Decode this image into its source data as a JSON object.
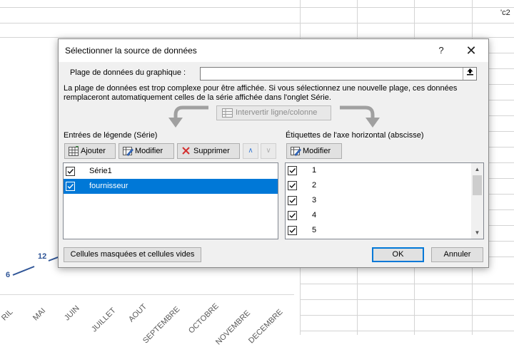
{
  "spreadsheet": {
    "cell_ref": "'c2",
    "chart_points": [
      "6",
      "12"
    ],
    "months": [
      "RIL",
      "MAI",
      "JUIN",
      "JUILLET",
      "AOUT",
      "SEPTEMBRE",
      "OCTOBRE",
      "NOVEMBRE",
      "DECEMBRE"
    ],
    "line_color": "#2f5597"
  },
  "dialog": {
    "title": "Sélectionner la source de données",
    "help_label": "?",
    "close_label": "✕",
    "range_label": "Plage de données du graphique :",
    "range_value": "",
    "range_button_icon": "collapse-dialog-icon",
    "message_line1": "La plage de données est trop complexe pour être affichée. Si vous sélectionnez une nouvelle plage, ces données",
    "message_line2": "remplaceront automatiquement celles de la série affichée dans l'onglet Série.",
    "switch_label": "Intervertir ligne/colonne",
    "legend": {
      "label": "Entrées de légende (Série)",
      "add_label": "Ajouter",
      "edit_label": "Modifier",
      "delete_label": "Supprimer",
      "up_label": "∧",
      "down_label": "∨",
      "series": [
        {
          "name": "Série1",
          "checked": true,
          "selected": false
        },
        {
          "name": "fournisseur",
          "checked": true,
          "selected": true
        }
      ]
    },
    "axis": {
      "label": "Étiquettes de l'axe horizontal (abscisse)",
      "edit_label": "Modifier",
      "items": [
        {
          "name": "1",
          "checked": true
        },
        {
          "name": "2",
          "checked": true
        },
        {
          "name": "3",
          "checked": true
        },
        {
          "name": "4",
          "checked": true
        },
        {
          "name": "5",
          "checked": true
        }
      ]
    },
    "hidden_cells_label": "Cellules masquées et cellules vides",
    "ok_label": "OK",
    "cancel_label": "Annuler"
  },
  "colors": {
    "selection": "#0078d7",
    "dialog_bg": "#f0f0f0"
  }
}
